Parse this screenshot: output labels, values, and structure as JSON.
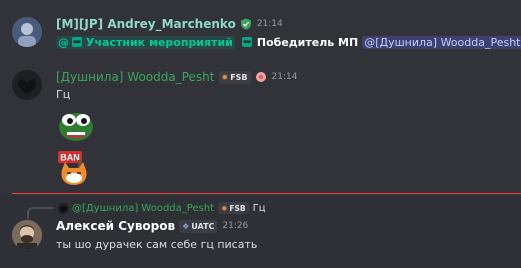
{
  "messages": [
    {
      "author": "[M][JP] Andrey_Marchenko",
      "author_color": "#8fd9c5",
      "timestamp": "21:14",
      "roles": [
        {
          "label": "Участник мероприятий",
          "color": "#00a885",
          "icon": "ninja-icon"
        },
        {
          "label": "Победитель МП",
          "color": "#ffffff",
          "icon": "ninja-icon"
        }
      ],
      "mention": "@[Душнила] Woodda_Pesht"
    },
    {
      "author": "[Душнила] Woodda_Pesht",
      "author_color": "#3ba55d",
      "tag": "FSB",
      "timestamp": "21:14",
      "text": "Гц",
      "stickers": [
        "pepe-emoji",
        "ban-cat-emoji"
      ]
    },
    {
      "reply_author": "@[Душнила] Woodda_Pesht",
      "reply_tag": "FSB",
      "reply_text": "Гц",
      "author": "Алексей Суворов",
      "author_color": "#ffffff",
      "tag": "UATC",
      "timestamp": "21:26",
      "text": "ты шо дурачек сам себе гц писать"
    }
  ]
}
